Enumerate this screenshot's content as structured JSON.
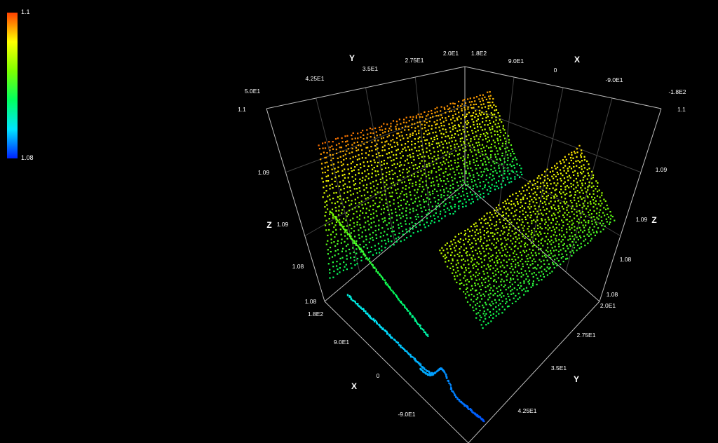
{
  "chart_data": {
    "type": "scatter",
    "title": "",
    "plot_style": "3d point cloud",
    "background": "#000000",
    "colorbar": {
      "max_label": "1.1",
      "min_label": "1.08",
      "colors": [
        "#0022ff",
        "#00e5ff",
        "#00ff60",
        "#7dff00",
        "#ffff00",
        "#ff4000"
      ]
    },
    "axes": {
      "x": {
        "label": "X",
        "ticks": [
          "1.8E2",
          "9.0E1",
          "0",
          "-9.0E1"
        ],
        "back_ticks": [
          "1.8E2",
          "9.0E1",
          "0",
          "-9.0E1",
          "-1.8E2"
        ],
        "range": [
          -180,
          180
        ]
      },
      "y": {
        "label": "Y",
        "ticks": [
          "2.0E1",
          "2.75E1",
          "3.5E1",
          "4.25E1"
        ],
        "back_ticks": [
          "2.0E1",
          "2.75E1",
          "3.5E1",
          "4.25E1",
          "5.0E1"
        ],
        "range": [
          20,
          50
        ]
      },
      "z": {
        "label": "Z",
        "left_ticks": [
          "1.1",
          "1.09",
          "1.09",
          "1.08",
          "1.08"
        ],
        "right_ticks": [
          "1.1",
          "1.09",
          "1.09",
          "1.08",
          "1.08"
        ],
        "range": [
          1.08,
          1.1
        ]
      }
    },
    "grid": true
  }
}
